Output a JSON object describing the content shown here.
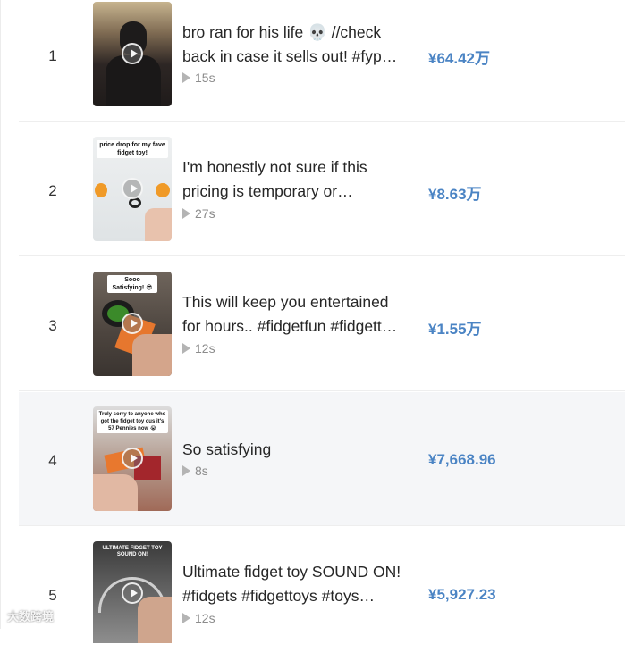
{
  "rows": [
    {
      "rank": "1",
      "title_line1": "bro ran for his life 💀 //check",
      "title_line2": "back in case it sells out! #fyp…",
      "duration": "15s",
      "price": "¥64.42万",
      "thumb_caption": "",
      "thumb_colors": [
        "#3b2f2a",
        "#c9b28f"
      ]
    },
    {
      "rank": "2",
      "title_line1": "I'm honestly not sure if this",
      "title_line2": "pricing is temporary or…",
      "duration": "27s",
      "price": "¥8.63万",
      "thumb_caption": "price drop for my fave fidget toy!",
      "thumb_colors": [
        "#d9dde0",
        "#f0a030"
      ]
    },
    {
      "rank": "3",
      "title_line1": "This will keep you entertained",
      "title_line2": "for hours.. #fidgetfun #fidgett…",
      "duration": "12s",
      "price": "¥1.55万",
      "thumb_caption": "Sooo Satisfying! 😎",
      "thumb_colors": [
        "#5a5048",
        "#d07a40"
      ]
    },
    {
      "rank": "4",
      "title_line1": "So satisfying",
      "title_line2": "",
      "duration": "8s",
      "price": "¥7,668.96",
      "thumb_caption": "Truly sorry to anyone who got the fidget toy cus it's 57 Pennies now 😭",
      "thumb_colors": [
        "#c89c88",
        "#e07a3a"
      ]
    },
    {
      "rank": "5",
      "title_line1": "Ultimate fidget toy SOUND ON!",
      "title_line2": "#fidgets #fidgettoys #toys…",
      "duration": "12s",
      "price": "¥5,927.23",
      "thumb_caption": "ULTIMATE FIDGET TOY SOUND ON!",
      "thumb_colors": [
        "#4a4a4a",
        "#8a8a8a"
      ]
    }
  ],
  "watermark": "大数跨境"
}
